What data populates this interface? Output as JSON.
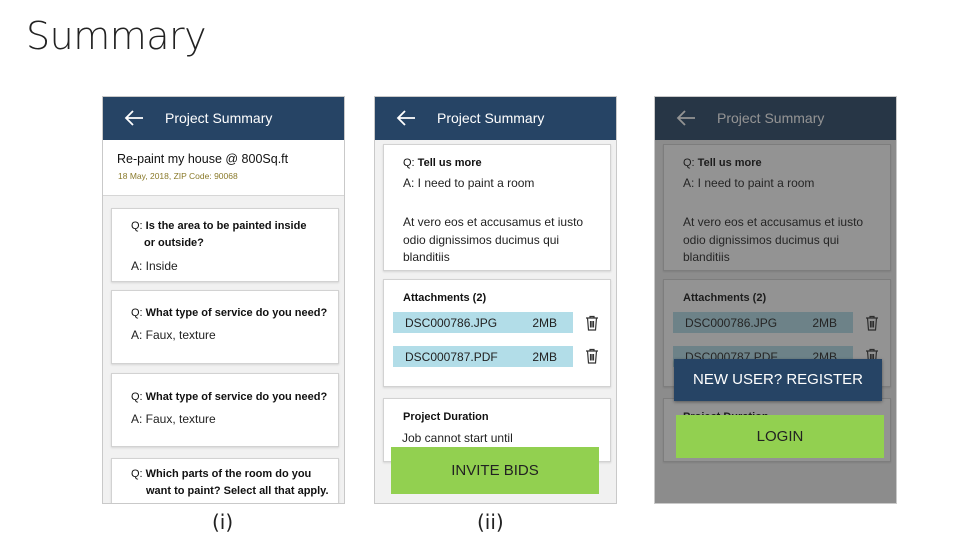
{
  "slide": {
    "title": "Summary"
  },
  "screens": [
    {
      "caption": "(i)",
      "appbar_title": "Project Summary",
      "header": {
        "title": "Re-paint my house @ 800Sq.ft",
        "meta": "18 May, 2018, ZIP Code: 90068"
      },
      "cards": [
        {
          "q_prefix": "Q: ",
          "q_line1": "Is the area to be painted inside",
          "q_line2": "or outside?",
          "answer": "A: Inside"
        },
        {
          "q_prefix": "Q: ",
          "q_line1": "What type of service do you need?",
          "answer": "A: Faux, texture"
        },
        {
          "q_prefix": "Q: ",
          "q_line1": "What type of service do you need?",
          "answer": "A: Faux, texture"
        },
        {
          "q_prefix": "Q: ",
          "q_line1": "Which parts of the room do you",
          "q_line2": "want to paint? Select all that apply."
        }
      ]
    },
    {
      "caption": "(ii)",
      "appbar_title": "Project Summary",
      "tell_card": {
        "q_prefix": "Q: ",
        "q_text": "Tell us more",
        "answer": "A: I need to paint a room",
        "body_line1": "At vero eos et accusamus et iusto",
        "body_line2": "odio dignissimos ducimus qui",
        "body_line3": "blanditiis"
      },
      "attachments": {
        "title": "Attachments (2)",
        "items": [
          {
            "name": "DSC000786.JPG",
            "size": "2MB"
          },
          {
            "name": "DSC000787.PDF",
            "size": "2MB"
          }
        ]
      },
      "duration": {
        "title": "Project Duration",
        "text": "Job cannot start until"
      },
      "invite_button": "INVITE BIDS"
    },
    {
      "appbar_title": "Project Summary",
      "tell_card": {
        "q_prefix": "Q: ",
        "q_text": "Tell us more",
        "answer": "A: I need to paint a room",
        "body_line1": "At vero eos et accusamus et iusto",
        "body_line2": "odio dignissimos ducimus qui",
        "body_line3": "blanditiis"
      },
      "attachments": {
        "title": "Attachments (2)",
        "items": [
          {
            "name": "DSC000786.JPG",
            "size": "2MB"
          },
          {
            "name": "DSC000787.PDF",
            "size": "2MB"
          }
        ]
      },
      "duration": {
        "title": "Project Duration"
      },
      "register_button": "NEW USER? REGISTER",
      "login_button": "LOGIN"
    }
  ],
  "colors": {
    "appbar": "#264465",
    "accent_green": "#92d050",
    "attachment_bg": "#b2dde8",
    "overlay": "rgba(40,40,40,0.5)"
  },
  "icons": {
    "back": "arrow-left",
    "delete": "trash-can"
  }
}
